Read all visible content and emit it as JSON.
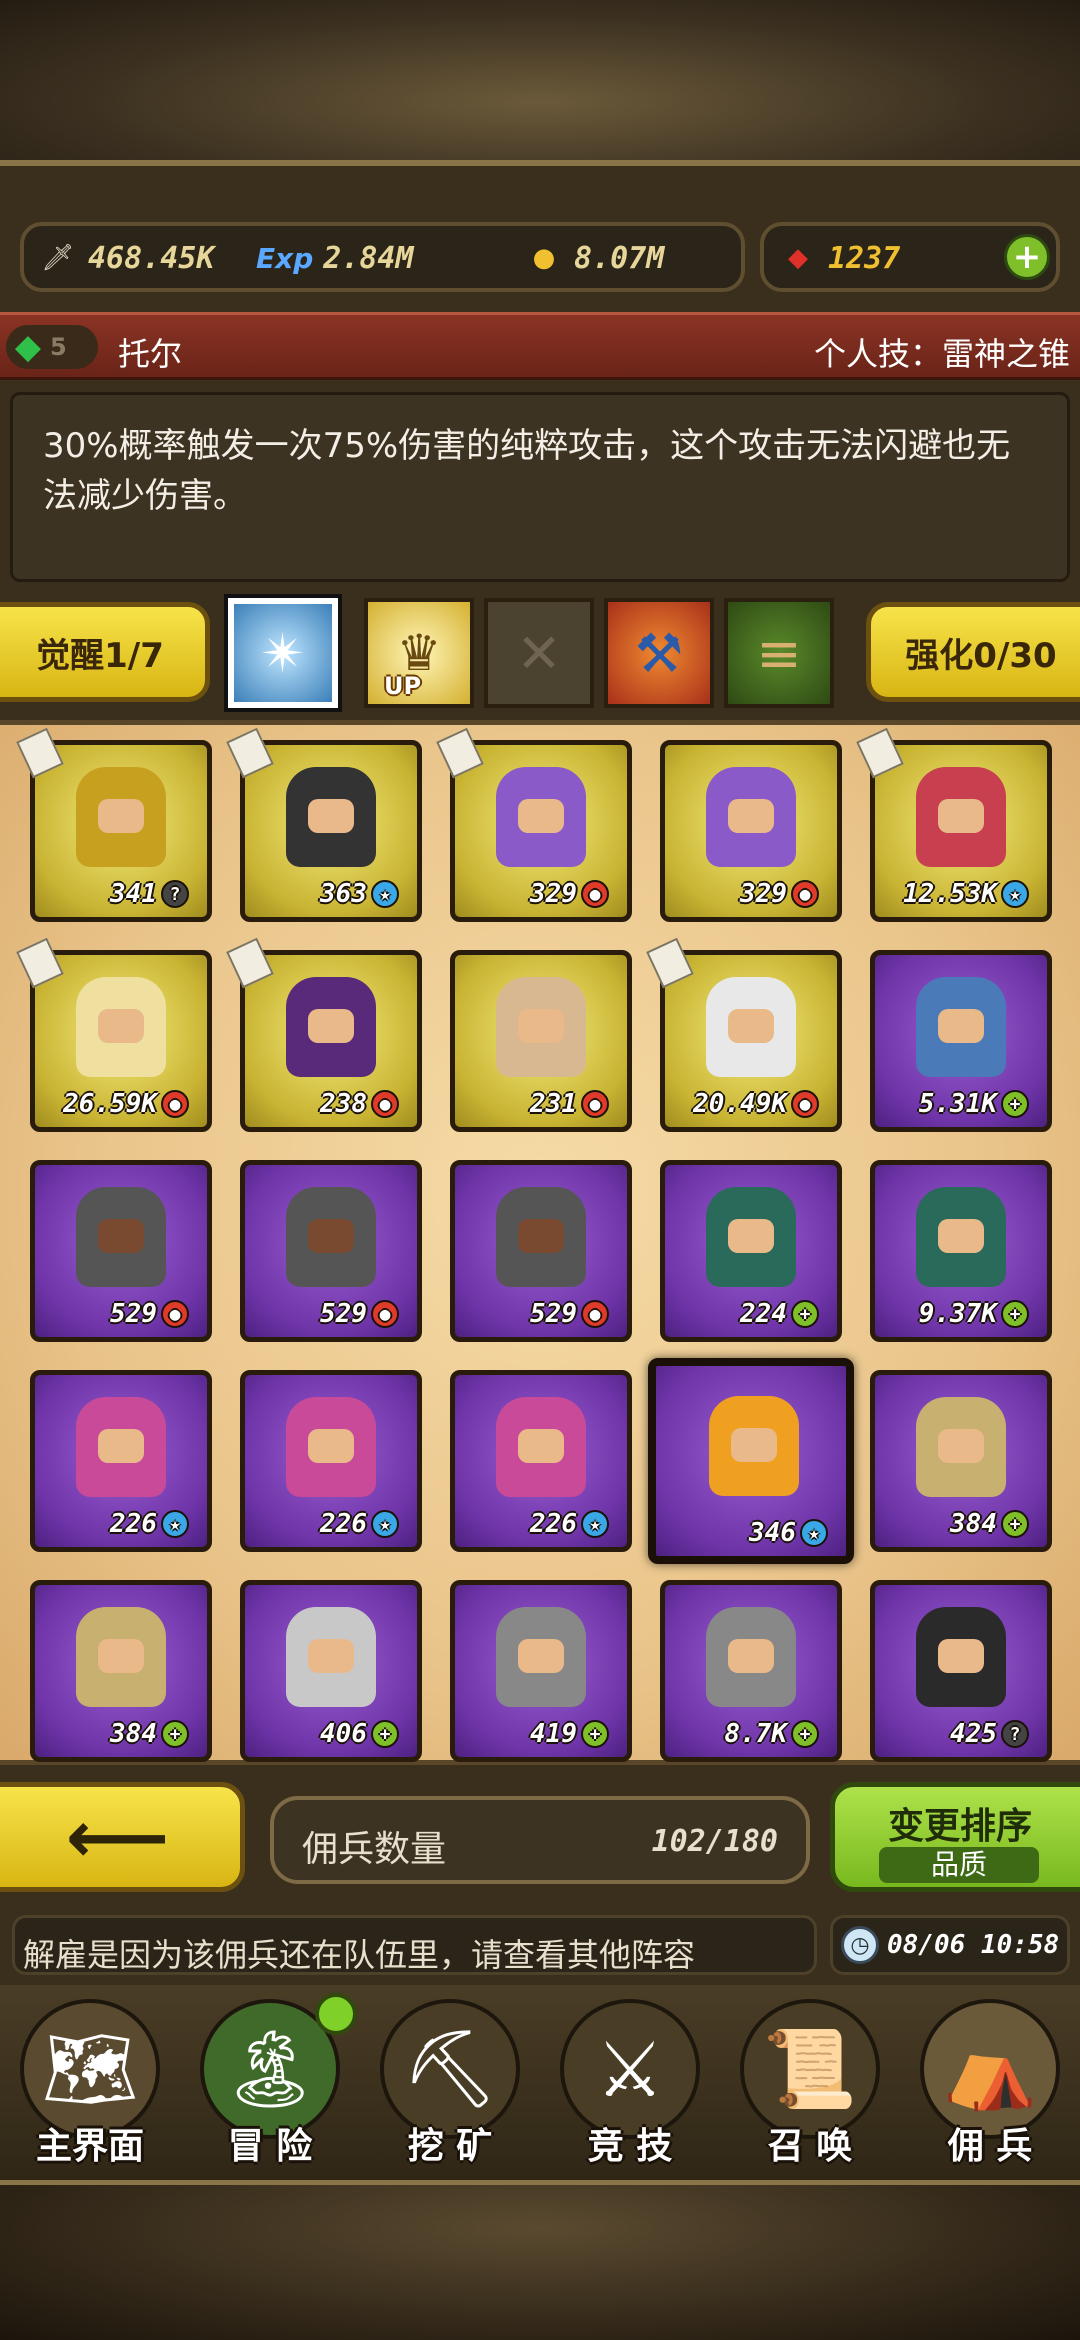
{
  "resources": {
    "attack": "468.45K",
    "exp_label": "Exp",
    "exp": "2.84M",
    "gold": "8.07M",
    "gems": "1237",
    "plus": "+"
  },
  "hero": {
    "level": "5",
    "name": "托尔",
    "skill_label": "个人技：雷神之锥",
    "description": "30%概率触发一次75%伤害的纯粹攻击，这个攻击无法闪避也无法减少伤害。"
  },
  "awaken": {
    "label": "觉醒1/7"
  },
  "enhance": {
    "label": "强化0/30"
  },
  "skill_slots": [
    {
      "icon": "blue-rune-icon",
      "glyph": "✴",
      "up": ""
    },
    {
      "icon": "crown-up-icon",
      "glyph": "♛",
      "up": "UP"
    },
    {
      "icon": "empty-x-icon",
      "glyph": "✕",
      "up": ""
    },
    {
      "icon": "hammer-icon",
      "glyph": "⚒",
      "up": ""
    },
    {
      "icon": "scroll-icon",
      "glyph": "📜",
      "up": ""
    }
  ],
  "mercenaries": [
    {
      "power": "341",
      "badge": "q",
      "rarity": "gold",
      "note": true
    },
    {
      "power": "363",
      "badge": "star",
      "rarity": "gold",
      "note": true
    },
    {
      "power": "329",
      "badge": "red",
      "rarity": "gold",
      "note": true
    },
    {
      "power": "329",
      "badge": "red",
      "rarity": "gold",
      "note": false
    },
    {
      "power": "12.53K",
      "badge": "star",
      "rarity": "gold",
      "note": true
    },
    {
      "power": "26.59K",
      "badge": "red",
      "rarity": "gold",
      "note": true
    },
    {
      "power": "238",
      "badge": "red",
      "rarity": "gold",
      "note": true
    },
    {
      "power": "231",
      "badge": "red",
      "rarity": "gold",
      "note": false
    },
    {
      "power": "20.49K",
      "badge": "red",
      "rarity": "gold",
      "note": true
    },
    {
      "power": "5.31K",
      "badge": "plus",
      "rarity": "purple",
      "note": false
    },
    {
      "power": "529",
      "badge": "red",
      "rarity": "purple",
      "note": false
    },
    {
      "power": "529",
      "badge": "red",
      "rarity": "purple",
      "note": false
    },
    {
      "power": "529",
      "badge": "red",
      "rarity": "purple",
      "note": false
    },
    {
      "power": "224",
      "badge": "plus",
      "rarity": "purple",
      "note": false
    },
    {
      "power": "9.37K",
      "badge": "plus",
      "rarity": "purple",
      "note": false
    },
    {
      "power": "226",
      "badge": "star",
      "rarity": "purple",
      "note": false
    },
    {
      "power": "226",
      "badge": "star",
      "rarity": "purple",
      "note": false
    },
    {
      "power": "226",
      "badge": "star",
      "rarity": "purple",
      "note": false
    },
    {
      "power": "346",
      "badge": "star",
      "rarity": "purple",
      "note": false,
      "selected": true
    },
    {
      "power": "384",
      "badge": "plus",
      "rarity": "purple",
      "note": false
    },
    {
      "power": "384",
      "badge": "plus",
      "rarity": "purple",
      "note": false
    },
    {
      "power": "406",
      "badge": "plus",
      "rarity": "purple",
      "note": false
    },
    {
      "power": "419",
      "badge": "plus",
      "rarity": "purple",
      "note": false
    },
    {
      "power": "8.7K",
      "badge": "plus",
      "rarity": "purple",
      "note": false
    },
    {
      "power": "425",
      "badge": "q",
      "rarity": "purple",
      "note": false
    }
  ],
  "badge_glyphs": {
    "q": "?",
    "star": "★",
    "red": "●",
    "plus": "+"
  },
  "footer": {
    "back_arrow": "⟵",
    "count_label": "佣兵数量",
    "count_value": "102/180",
    "sort_title": "变更排序",
    "sort_sub": "品质",
    "ticker": "解雇是因为该佣兵还在队伍里，请查看其他阵容",
    "time": "08/06 10:58"
  },
  "nav": [
    {
      "label": "主界面",
      "icon": "map-scroll-icon",
      "glyph": "🗺"
    },
    {
      "label": "冒 险",
      "icon": "island-icon",
      "glyph": "🏝"
    },
    {
      "label": "挖 矿",
      "icon": "pickaxe-icon",
      "glyph": "⛏"
    },
    {
      "label": "竞 技",
      "icon": "crossed-swords-icon",
      "glyph": "⚔"
    },
    {
      "label": "召 唤",
      "icon": "summon-scroll-icon",
      "glyph": "📜"
    },
    {
      "label": "佣 兵",
      "icon": "tent-icon",
      "glyph": "⛺"
    }
  ]
}
